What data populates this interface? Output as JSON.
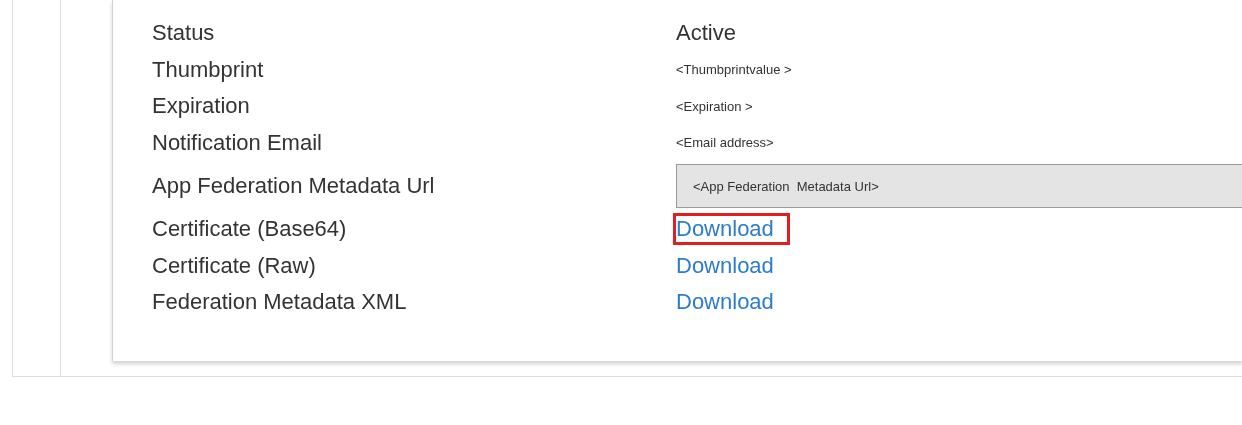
{
  "properties": [
    {
      "label": "Status",
      "kind": "text",
      "value": "Active"
    },
    {
      "label": "Thumbprint",
      "kind": "small",
      "value": "<Thumbprintvalue >"
    },
    {
      "label": "Expiration",
      "kind": "small",
      "value": "<Expiration >"
    },
    {
      "label": "Notification Email",
      "kind": "small",
      "value": "<Email address>"
    },
    {
      "label": "App Federation Metadata Url",
      "kind": "field",
      "value": "<App Federation  Metadata Url>"
    },
    {
      "label": "Certificate (Base64)",
      "kind": "link",
      "value": "Download",
      "highlighted": true
    },
    {
      "label": "Certificate (Raw)",
      "kind": "link",
      "value": "Download",
      "highlighted": false
    },
    {
      "label": "Federation Metadata XML",
      "kind": "link",
      "value": "Download",
      "highlighted": false
    }
  ]
}
